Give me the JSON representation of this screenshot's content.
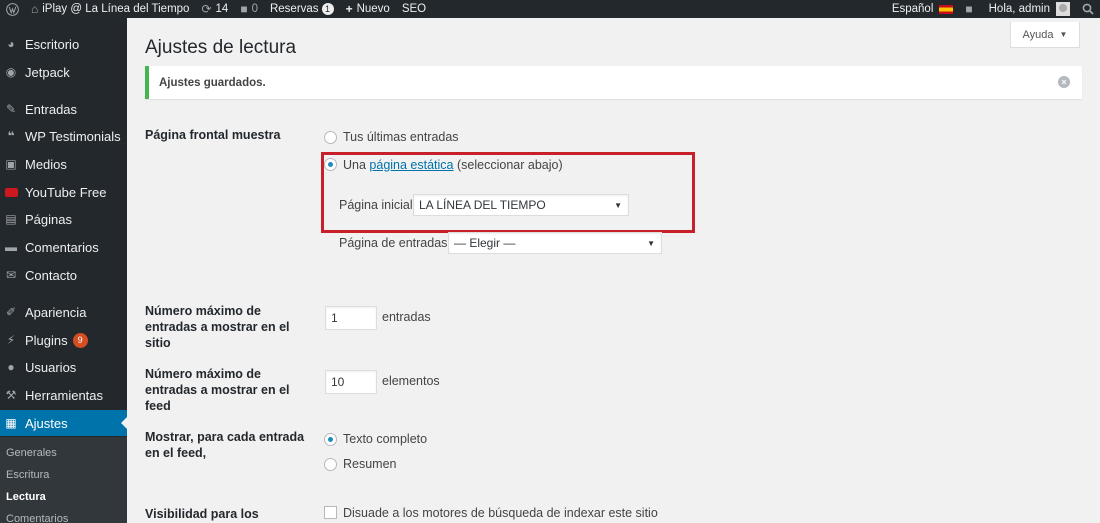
{
  "adminbar": {
    "site_name": "iPlay @ La Línea del Tiempo",
    "updates_count": "14",
    "comments_count": "0",
    "reservas_label": "Reservas",
    "reservas_count": "1",
    "new_label": "Nuevo",
    "seo_label": "SEO",
    "language": "Español",
    "greeting": "Hola, admin"
  },
  "sidebar": {
    "items": [
      {
        "label": "Escritorio",
        "icon": "dashboard-icon"
      },
      {
        "label": "Jetpack",
        "icon": "jetpack-icon"
      },
      {
        "label": "Entradas",
        "icon": "pin-icon"
      },
      {
        "label": "WP Testimonials",
        "icon": "quote-icon"
      },
      {
        "label": "Medios",
        "icon": "media-icon"
      },
      {
        "label": "YouTube Free",
        "icon": "youtube-icon"
      },
      {
        "label": "Páginas",
        "icon": "pages-icon"
      },
      {
        "label": "Comentarios",
        "icon": "comment-icon"
      },
      {
        "label": "Contacto",
        "icon": "mail-icon"
      },
      {
        "label": "Apariencia",
        "icon": "brush-icon"
      },
      {
        "label": "Plugins",
        "icon": "plugin-icon",
        "badge": "9"
      },
      {
        "label": "Usuarios",
        "icon": "user-icon"
      },
      {
        "label": "Herramientas",
        "icon": "wrench-icon"
      },
      {
        "label": "Ajustes",
        "icon": "settings-icon",
        "current": true
      }
    ],
    "submenu": [
      "Generales",
      "Escritura",
      "Lectura",
      "Comentarios"
    ]
  },
  "main": {
    "help_label": "Ayuda",
    "title": "Ajustes de lectura",
    "notice": "Ajustes guardados.",
    "front_page": {
      "label": "Página frontal muestra",
      "option_latest": "Tus últimas entradas",
      "option_static_prefix": "Una",
      "option_static_link": "página estática",
      "option_static_suffix": "(seleccionar abajo)",
      "home_label": "Página inicial:",
      "home_value": "LA LÍNEA DEL TIEMPO",
      "posts_label": "Página de entradas:",
      "posts_value": "— Elegir —"
    },
    "posts_per_page": {
      "label": "Número máximo de entradas a mostrar en el sitio",
      "value": "1",
      "unit": "entradas"
    },
    "posts_per_rss": {
      "label": "Número máximo de entradas a mostrar en el feed",
      "value": "10",
      "unit": "elementos"
    },
    "feed_show": {
      "label": "Mostrar, para cada entrada en el feed,",
      "option_full": "Texto completo",
      "option_summary": "Resumen"
    },
    "visibility": {
      "label": "Visibilidad para los",
      "option": "Disuade a los motores de búsqueda de indexar este sitio"
    }
  },
  "colors": {
    "adminbar_bg": "#23282d",
    "accent": "#0073aa",
    "highlight_box": "#c8202a",
    "notice_border": "#46b450"
  }
}
